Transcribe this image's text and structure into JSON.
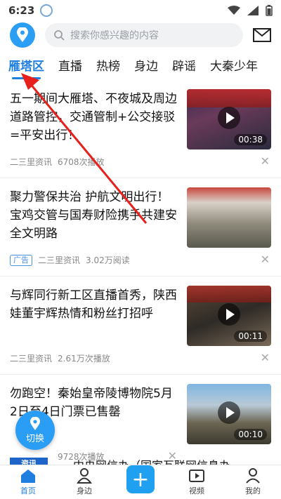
{
  "status": {
    "time": "6:23"
  },
  "header": {
    "search_placeholder": "搜索你感兴趣的内容"
  },
  "tabs": [
    "雁塔区",
    "直播",
    "热榜",
    "身边",
    "辟谣",
    "大秦少年"
  ],
  "feed": [
    {
      "title": "五一期间大雁塔、不夜城及周边道路管控，交通管制+公交接驳=平安出行！",
      "source": "二三里资讯",
      "stat": "6708次播放",
      "duration": "00:38",
      "ad": ""
    },
    {
      "title": "聚力警保共治 护航文明出行！宝鸡交管与国寿财险携手共建安全文明路",
      "source": "二三里资讯",
      "stat": "3.02万阅读",
      "duration": "",
      "ad": "广告"
    },
    {
      "title": "与辉同行新工区直播首秀，陕西娃董宇辉热情和粉丝打招呼",
      "source": "二三里资讯",
      "stat": "2.61万次播放",
      "duration": "00:11",
      "ad": ""
    },
    {
      "title": "勿跑空！秦始皇帝陵博物院5月2日至4日门票已售罄",
      "source": "",
      "stat": "9728次播放",
      "duration": "00:10",
      "ad": ""
    }
  ],
  "peek": {
    "title": "中央网信办（国家互联网信息办",
    "logo": "资讯"
  },
  "fab": {
    "label": "切换"
  },
  "bottom_nav": [
    "首页",
    "身边",
    "视频",
    "我的"
  ],
  "colors": {
    "accent": "#1e7fe0",
    "brand": "#2a9df4",
    "arrow": "#e8201c"
  }
}
